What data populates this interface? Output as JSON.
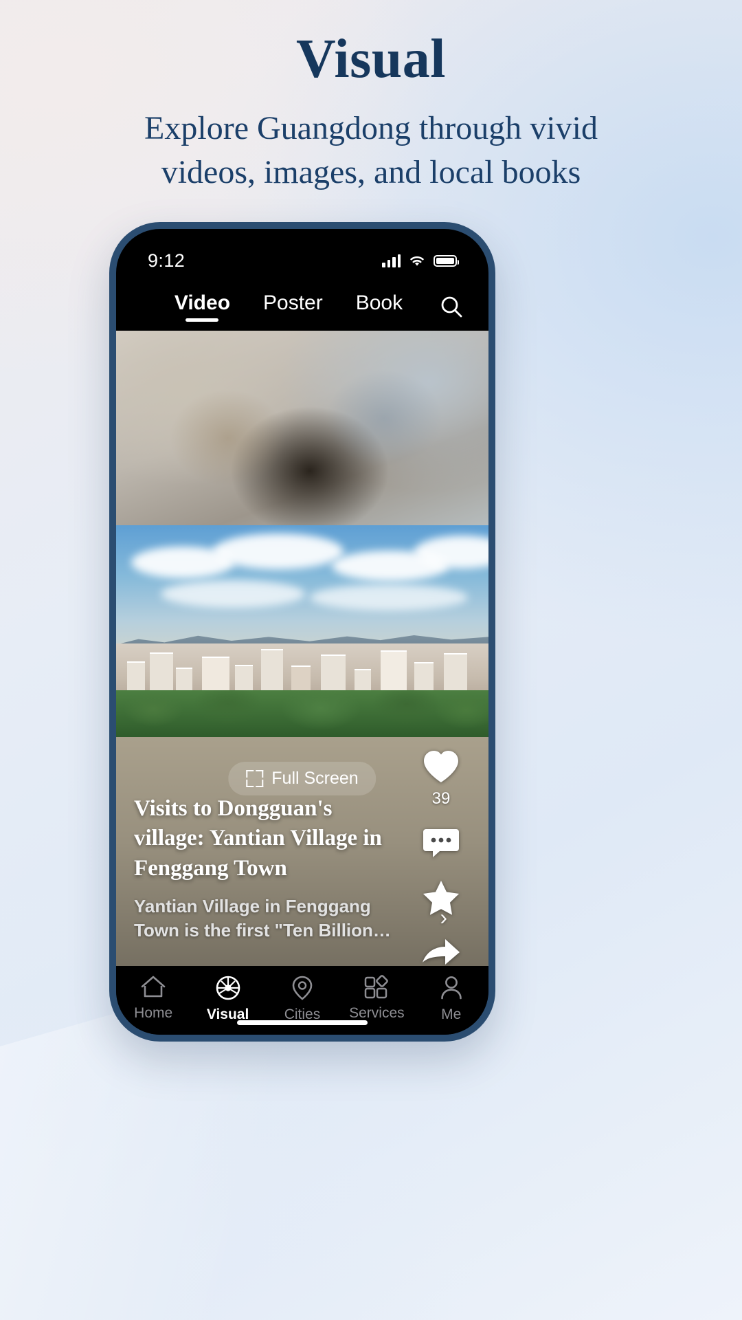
{
  "hero": {
    "title": "Visual",
    "subtitle": "Explore Guangdong through vivid videos, images, and local books",
    "title_color": "#16375c",
    "subtitle_color": "#1b3f69"
  },
  "phone": {
    "bezel_color": "#2b4d71",
    "statusbar": {
      "time": "9:12",
      "icons": [
        "cellular-signal-icon",
        "wifi-icon",
        "battery-icon"
      ]
    },
    "top_tabs": {
      "items": [
        {
          "label": "Video",
          "active": true
        },
        {
          "label": "Poster",
          "active": false
        },
        {
          "label": "Book",
          "active": false
        }
      ],
      "search_icon": "search-icon"
    },
    "player": {
      "fullscreen_label": "Full Screen",
      "fullscreen_icon": "expand-icon",
      "actions": [
        {
          "icon": "heart-icon",
          "name": "like",
          "count": "39"
        },
        {
          "icon": "comment-icon",
          "name": "comment",
          "count": ""
        },
        {
          "icon": "star-icon",
          "name": "favorite",
          "count": ""
        },
        {
          "icon": "share-arrow-icon",
          "name": "share",
          "count": ""
        }
      ],
      "caption": {
        "title": "Visits to Dongguan's village: Yantian Village in Fenggang Town",
        "description": "Yantian Village in Fenggang Town is the first \"Ten Billion Yuan Village\" in...",
        "expand_icon": "chevron-right-icon"
      }
    },
    "bottom_nav": {
      "items": [
        {
          "label": "Home",
          "icon": "home-icon",
          "active": false
        },
        {
          "label": "Visual",
          "icon": "aperture-icon",
          "active": true
        },
        {
          "label": "Cities",
          "icon": "location-pin-icon",
          "active": false
        },
        {
          "label": "Services",
          "icon": "grid-apps-icon",
          "active": false
        },
        {
          "label": "Me",
          "icon": "person-icon",
          "active": false
        }
      ],
      "active_color": "#ffffff",
      "inactive_color": "#8e8e93"
    }
  }
}
